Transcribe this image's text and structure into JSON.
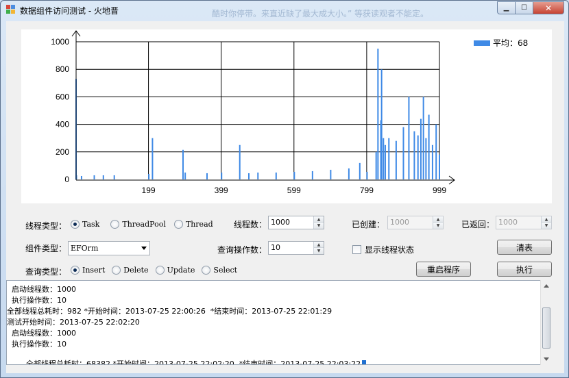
{
  "window": {
    "title": "数据组件访问测试 - 火地晋",
    "ghost_text": "酷时你停带。来直近缺了最大成大小。” 等获读观者不能定。"
  },
  "chart_data": {
    "type": "bar",
    "x_ticks": [
      199,
      399,
      599,
      799,
      999
    ],
    "y_ticks": [
      0,
      200,
      400,
      600,
      800,
      1000
    ],
    "ylim": [
      0,
      1000
    ],
    "xlim": [
      0,
      999
    ],
    "grid": true,
    "legend_position": "top-right",
    "series": [
      {
        "name": "平均：68",
        "color": "#3f8ae6",
        "x": [
          0,
          1,
          15,
          50,
          75,
          105,
          200,
          210,
          294,
          300,
          360,
          400,
          450,
          475,
          500,
          550,
          600,
          650,
          700,
          750,
          780,
          800,
          825,
          830,
          838,
          840,
          845,
          850,
          860,
          880,
          900,
          915,
          930,
          940,
          948,
          955,
          962,
          970,
          980,
          990,
          999
        ],
        "y": [
          730,
          30,
          25,
          30,
          30,
          30,
          40,
          300,
          215,
          50,
          45,
          50,
          250,
          45,
          50,
          50,
          55,
          60,
          70,
          80,
          120,
          55,
          200,
          950,
          430,
          800,
          300,
          250,
          300,
          280,
          380,
          600,
          350,
          320,
          440,
          600,
          300,
          470,
          250,
          400,
          180
        ]
      }
    ]
  },
  "controls": {
    "thread_type_label": "线程类型：",
    "thread_options": [
      "Task",
      "ThreadPool",
      "Thread"
    ],
    "thread_selected": "Task",
    "thread_count_label": "线程数：",
    "thread_count_value": "1000",
    "created_label": "已创建：",
    "created_value": "1000",
    "returned_label": "已返回：",
    "returned_value": "1000",
    "component_type_label": "组件类型：",
    "component_value": "EFOrm",
    "query_ops_label": "查询操作数：",
    "query_ops_value": "10",
    "show_thread_state_label": "显示线程状态",
    "clear_button": "清表",
    "query_type_label": "查询类型：",
    "query_options": [
      "Insert",
      "Delete",
      "Update",
      "Select"
    ],
    "query_selected": "Insert",
    "restart_button": "重启程序",
    "execute_button": "执行"
  },
  "log": {
    "lines": [
      "  启动线程数：1000",
      "  执行操作数：10",
      "全部线程总耗时：982 *开始时间：2013-07-25 22:00:26  *结束时间：2013-07-25 22:01:29",
      "测试开始时间：2013-07-25 22:02:20",
      "  启动线程数：1000",
      "  执行操作数：10",
      "全部线程总耗时：68382 *开始时间：2013-07-25 22:02:20  *结束时间：2013-07-25 22:03:22"
    ]
  }
}
